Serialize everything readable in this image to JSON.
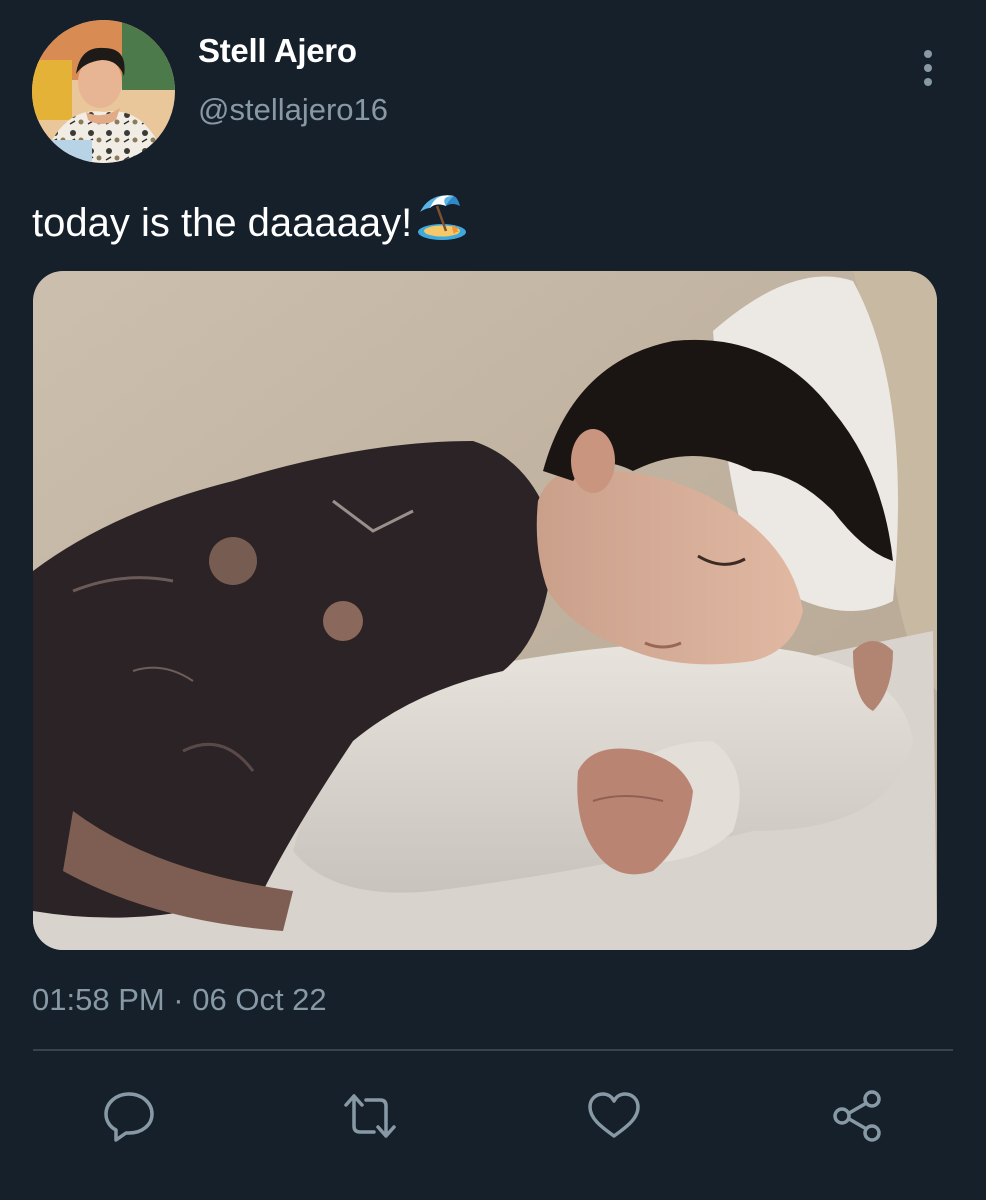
{
  "user": {
    "display_name": "Stell Ajero",
    "handle": "@stellajero16"
  },
  "tweet": {
    "text": "today is the daaaaay!",
    "emoji_icon": "beach-umbrella-icon",
    "media_alt": "photo of a person sleeping on white pillows",
    "timestamp": "01:58 PM · 06 Oct 22"
  },
  "actions": [
    {
      "name": "reply",
      "icon": "speech-bubble-icon"
    },
    {
      "name": "retweet",
      "icon": "retweet-arrows-icon"
    },
    {
      "name": "like",
      "icon": "heart-icon"
    },
    {
      "name": "share",
      "icon": "share-nodes-icon"
    }
  ],
  "colors": {
    "background": "#15202b",
    "primary_text": "#ffffff",
    "secondary_text": "#8899a6",
    "divider": "#38444d",
    "icon": "#8899a6"
  }
}
